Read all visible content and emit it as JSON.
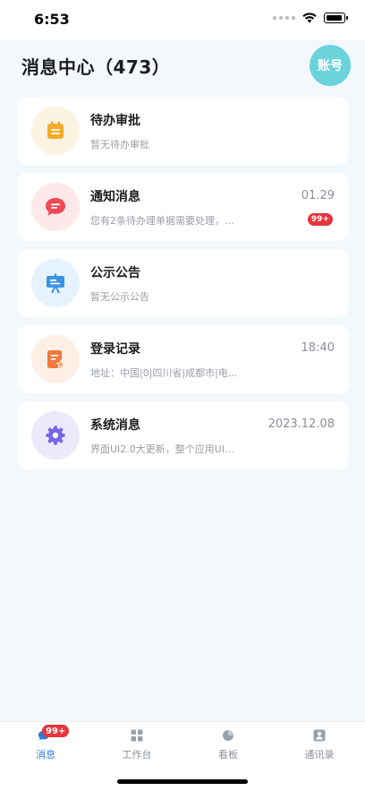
{
  "status_bar": {
    "time": "6:53"
  },
  "header": {
    "title": "消息中心（473）",
    "account_label": "账号"
  },
  "messages": [
    {
      "title": "待办审批",
      "subtitle": "暂无待办审批",
      "time": "",
      "badge": "",
      "icon": "calendar-icon",
      "icon_bg": "#fdf3e2",
      "icon_color": "#f4ad2b"
    },
    {
      "title": "通知消息",
      "subtitle": "您有2条待办理单据需要处理，…",
      "time": "01.29",
      "badge": "99+",
      "icon": "chat-bubble-icon",
      "icon_bg": "#fde8ea",
      "icon_color": "#ee4a57"
    },
    {
      "title": "公示公告",
      "subtitle": "暂无公示公告",
      "time": "",
      "badge": "",
      "icon": "presentation-board-icon",
      "icon_bg": "#e6f3fd",
      "icon_color": "#3b93e4"
    },
    {
      "title": "登录记录",
      "subtitle": "地址：中国|0|四川省|成都市|电…",
      "time": "18:40",
      "badge": "",
      "icon": "document-star-icon",
      "icon_bg": "#fdefe6",
      "icon_color": "#f07a3c"
    },
    {
      "title": "系统消息",
      "subtitle": "界面UI2.0大更新，整个应用UI…",
      "time": "2023.12.08",
      "badge": "",
      "icon": "gear-icon",
      "icon_bg": "#ece9fb",
      "icon_color": "#7668e6"
    }
  ],
  "tabbar": {
    "tabs": [
      {
        "label": "消息",
        "icon": "message-icon",
        "badge": "99+",
        "active": true
      },
      {
        "label": "工作台",
        "icon": "grid-icon",
        "badge": "",
        "active": false
      },
      {
        "label": "看板",
        "icon": "dashboard-icon",
        "badge": "",
        "active": false
      },
      {
        "label": "通讯录",
        "icon": "contacts-icon",
        "badge": "",
        "active": false
      }
    ]
  },
  "colors": {
    "accent": "#2f7dd8",
    "account_bg": "#6ad3dc",
    "badge": "#e8343c",
    "background": "#f3f8fd"
  }
}
